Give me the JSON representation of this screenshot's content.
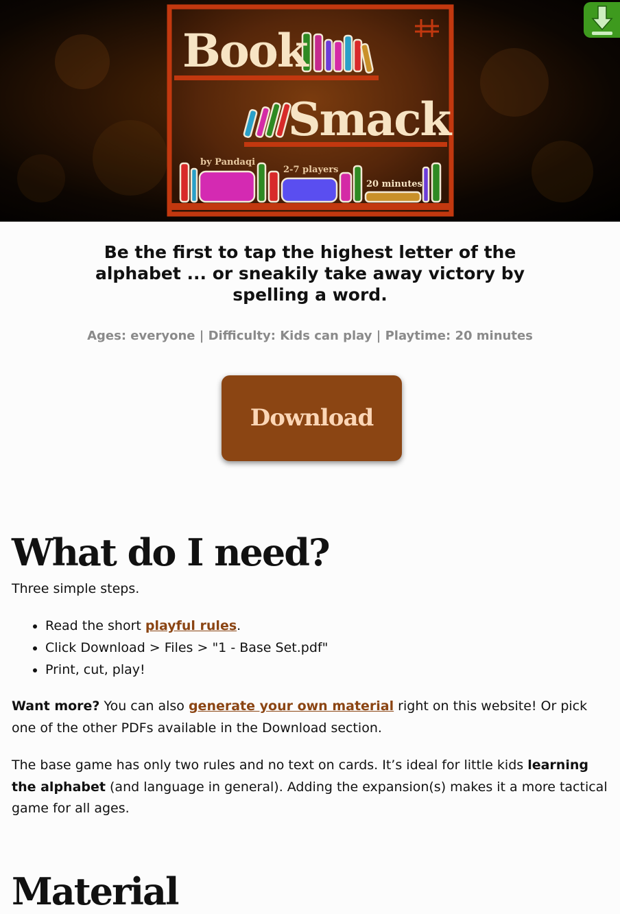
{
  "hero": {
    "title_line1": "Book",
    "title_line2": "Smack",
    "byline": "by Pandaqi",
    "players": "2-7 players",
    "playtime": "20 minutes"
  },
  "tagline": "Be the first to tap the highest letter of the alphabet ... or sneakily take away victory by spelling a word.",
  "meta": "Ages: everyone | Difficulty: Kids can play | Playtime: 20 minutes",
  "download_button": "Download",
  "what_section": {
    "heading": "What do I need?",
    "intro": "Three simple steps.",
    "steps": [
      {
        "before": "Read the short ",
        "link": "playful rules",
        "after": "."
      },
      {
        "text": "Click Download > Files > \"1 - Base Set.pdf\""
      },
      {
        "text": "Print, cut, play!"
      }
    ],
    "more": {
      "bold": "Want more?",
      "before": " You can also ",
      "link": "generate your own material",
      "after": " right on this website! Or pick one of the other PDFs available in the Download section."
    },
    "base": {
      "before": "The base game has only two rules and no text on cards. It’s ideal for little kids ",
      "bold": "learning the alphabet",
      "after": " (and language in general). Adding the expansion(s) makes it a more tactical game for all ages."
    }
  },
  "material_heading": "Material",
  "colors": {
    "accent": "#8b4513",
    "button_text": "#fbd6b6",
    "badge": "#3e9a1e",
    "meta_text": "#8a8a8a"
  }
}
